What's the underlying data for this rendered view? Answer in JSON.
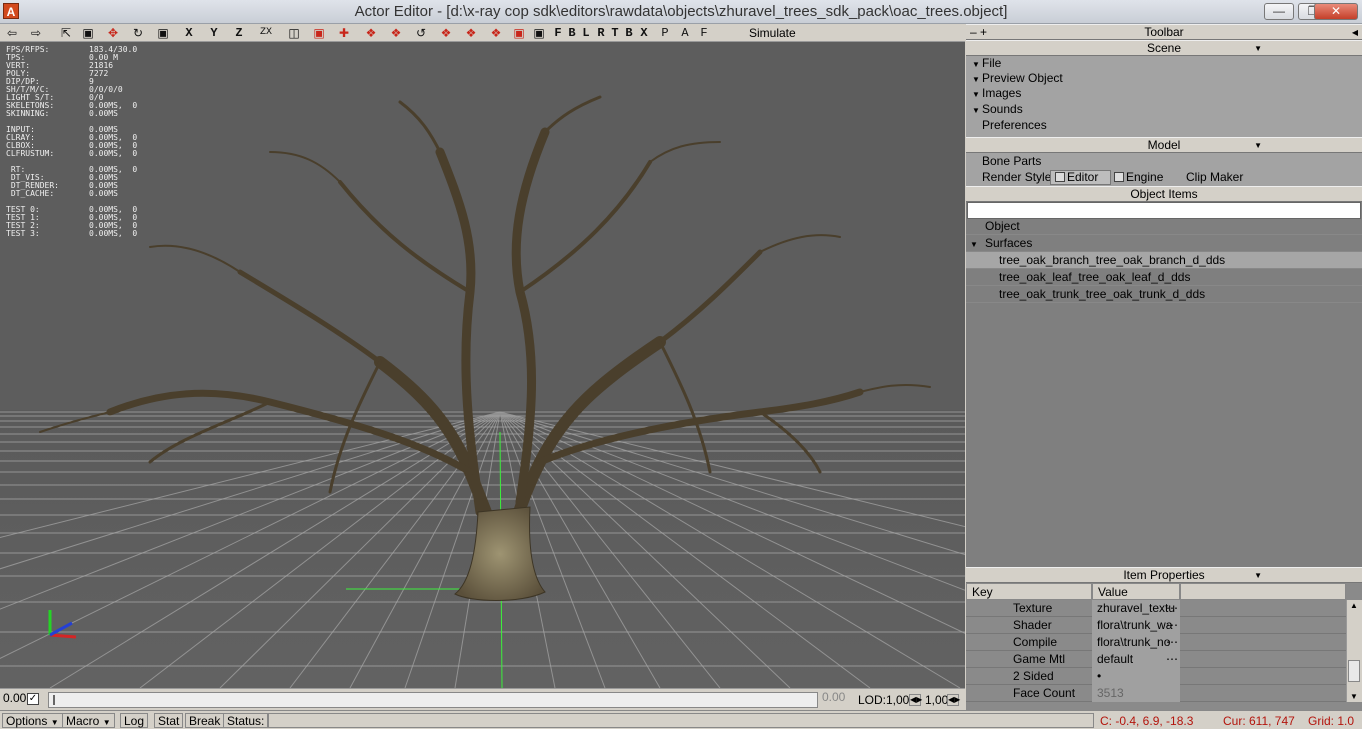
{
  "window": {
    "title": "Actor Editor - [d:\\x-ray cop sdk\\editors\\rawdata\\objects\\zhuravel_trees_sdk_pack\\oac_trees.object]",
    "app_icon": "A"
  },
  "toolbar": {
    "axis_x": "X",
    "axis_y": "Y",
    "axis_z": "Z",
    "axis_zx": "ZX",
    "letters": [
      "F",
      "B",
      "L",
      "R",
      "T",
      "B",
      "X",
      "P",
      "A",
      "F"
    ],
    "simulate": "Simulate"
  },
  "stats": [
    [
      "FPS/RFPS:",
      "183.4/30.0"
    ],
    [
      "TPS:",
      "0.00 M"
    ],
    [
      "VERT:",
      "21816"
    ],
    [
      "POLY:",
      "7272"
    ],
    [
      "DIP/DP:",
      "9"
    ],
    [
      "SH/T/M/C:",
      "0/0/0/0"
    ],
    [
      "LIGHT S/T:",
      "0/0"
    ],
    [
      "SKELETONS:",
      "0.00MS,  0"
    ],
    [
      "SKINNING:",
      "0.00MS"
    ],
    [
      "",
      ""
    ],
    [
      "INPUT:",
      "0.00MS"
    ],
    [
      "CLRAY:",
      "0.00MS,  0"
    ],
    [
      "CLBOX:",
      "0.00MS,  0"
    ],
    [
      "CLFRUSTUM:",
      "0.00MS,  0"
    ],
    [
      "",
      ""
    ],
    [
      " RT:",
      "0.00MS,  0"
    ],
    [
      " DT_VIS:",
      "0.00MS"
    ],
    [
      " DT_RENDER:",
      "0.00MS"
    ],
    [
      " DT_CACHE:",
      "0.00MS"
    ],
    [
      "",
      ""
    ],
    [
      "TEST 0:",
      "0.00MS,  0"
    ],
    [
      "TEST 1:",
      "0.00MS,  0"
    ],
    [
      "TEST 2:",
      "0.00MS,  0"
    ],
    [
      "TEST 3:",
      "0.00MS,  0"
    ]
  ],
  "panel": {
    "toolbar_title": "Toolbar",
    "scene": {
      "title": "Scene",
      "items": [
        "File",
        "Preview Object",
        "Images",
        "Sounds",
        "Preferences"
      ]
    },
    "model": {
      "title": "Model",
      "bone_parts": "Bone Parts",
      "render_style_label": "Render Style:",
      "editor": "Editor",
      "engine": "Engine",
      "clip_maker": "Clip Maker"
    },
    "object_items": {
      "title": "Object Items",
      "object": "Object",
      "surfaces": "Surfaces",
      "surface_list": [
        "tree_oak_branch_tree_oak_branch_d_dds",
        "tree_oak_leaf_tree_oak_leaf_d_dds",
        "tree_oak_trunk_tree_oak_trunk_d_dds"
      ]
    },
    "item_properties": {
      "title": "Item Properties",
      "col_key": "Key",
      "col_value": "Value",
      "rows": [
        {
          "key": "Texture",
          "value": "zhuravel_textu"
        },
        {
          "key": "Shader",
          "value": "flora\\trunk_wa"
        },
        {
          "key": "Compile",
          "value": "flora\\trunk_no"
        },
        {
          "key": "Game Mtl",
          "value": "default"
        },
        {
          "key": "2 Sided",
          "value": "•"
        },
        {
          "key": "Face Count",
          "value": "3513"
        }
      ]
    }
  },
  "timebar": {
    "start": "0.00",
    "end": "0.00",
    "lod_label": "LOD:",
    "lod_value": "1,00",
    "lod_value2": "1,00"
  },
  "statusbar": {
    "options": "Options",
    "macro": "Macro",
    "log": "Log",
    "stat": "Stat",
    "break": "Break",
    "status": "Status:",
    "coords": "C: -0.4, 6.9, -18.3",
    "cursor": "Cur: 611, 747",
    "grid": "Grid: 1.0"
  }
}
